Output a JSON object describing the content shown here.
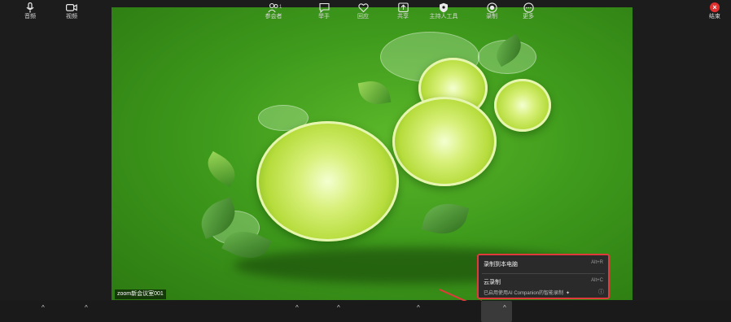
{
  "video": {
    "participant_name": "zoom新会议室001"
  },
  "recording_menu": {
    "items": [
      {
        "label": "录制到本电脑",
        "shortcut": "Alt+R"
      },
      {
        "label": "云录制",
        "shortcut": "Alt+C"
      }
    ],
    "ai_note": "已启用使用AI Companion的智能录制"
  },
  "toolbar": {
    "audio": {
      "label": "音频",
      "icon": "microphone-icon"
    },
    "video": {
      "label": "视频",
      "icon": "camera-icon"
    },
    "participants": {
      "label": "参会者",
      "count": "1",
      "icon": "participants-icon"
    },
    "raise_hand": {
      "label": "举手",
      "icon": "chat-icon"
    },
    "reactions": {
      "label": "回应",
      "icon": "heart-icon"
    },
    "share": {
      "label": "共享",
      "icon": "share-icon"
    },
    "host_tools": {
      "label": "主持人工具",
      "icon": "shield-icon"
    },
    "record": {
      "label": "录制",
      "icon": "record-icon"
    },
    "more": {
      "label": "更多",
      "icon": "more-icon"
    },
    "end": {
      "label": "结束",
      "icon": "close-icon"
    }
  },
  "colors": {
    "highlight": "#e03a3a",
    "end_button": "#e0302f"
  }
}
